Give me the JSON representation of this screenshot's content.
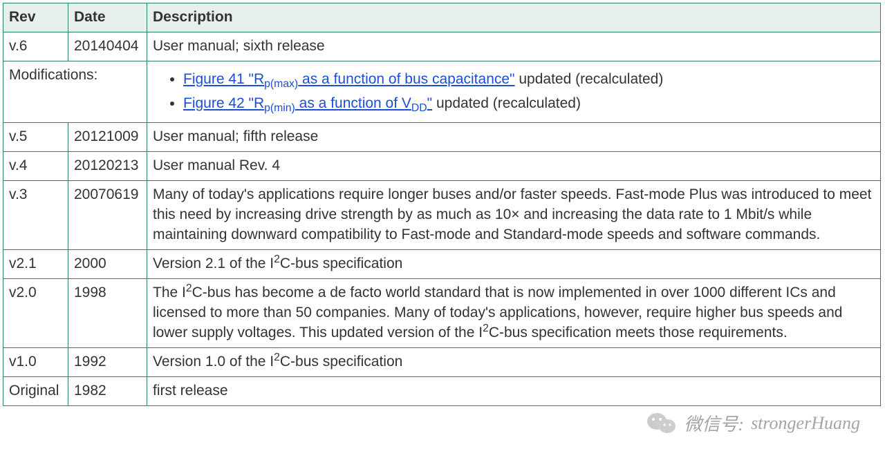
{
  "headers": {
    "rev": "Rev",
    "date": "Date",
    "desc": "Description"
  },
  "mods_label": "Modifications:",
  "mods": [
    {
      "link_pre": "Figure 41 \"R",
      "link_sub": "p(max)",
      "link_post": " as a function of bus capacitance\"",
      "suffix": " updated (recalculated)"
    },
    {
      "link_pre": "Figure 42 \"R",
      "link_sub": "p(min)",
      "link_mid": " as a function of V",
      "link_sub2": "DD",
      "link_post": "\"",
      "suffix": " updated (recalculated)"
    }
  ],
  "rows": [
    {
      "rev": "v.6",
      "date": "20140404",
      "desc_plain": "User manual; sixth release"
    },
    {
      "rev": "v.5",
      "date": "20121009",
      "desc_plain": "User manual; fifth release"
    },
    {
      "rev": "v.4",
      "date": "20120213",
      "desc_plain": "User manual Rev. 4"
    },
    {
      "rev": "v.3",
      "date": "20070619",
      "desc_plain": "Many of today's applications require longer buses and/or faster speeds. Fast-mode Plus was introduced to meet this need by increasing drive strength by as much as 10× and increasing the data rate to 1 Mbit/s while maintaining downward compatibility to Fast-mode and Standard-mode speeds and software commands."
    },
    {
      "rev": "v2.1",
      "date": "2000",
      "desc_i2c_pre": "Version 2.1 of the I",
      "desc_i2c_post": "C-bus specification"
    },
    {
      "rev": "v2.0",
      "date": "1998",
      "desc_i2c_multi": {
        "p1": "The I",
        "p2": "C-bus has become a de facto world standard that is now implemented in over 1000 different ICs and licensed to more than 50 companies. Many of today's applications, however, require higher bus speeds and lower supply voltages. This updated version of the I",
        "p3": "C-bus specification meets those requirements."
      }
    },
    {
      "rev": "v1.0",
      "date": "1992",
      "desc_i2c_pre": "Version 1.0 of the I",
      "desc_i2c_post": "C-bus specification"
    },
    {
      "rev": "Original",
      "date": "1982",
      "desc_plain": "first release"
    }
  ],
  "watermark": {
    "label": "微信号:",
    "handle": "strongerHuang"
  }
}
